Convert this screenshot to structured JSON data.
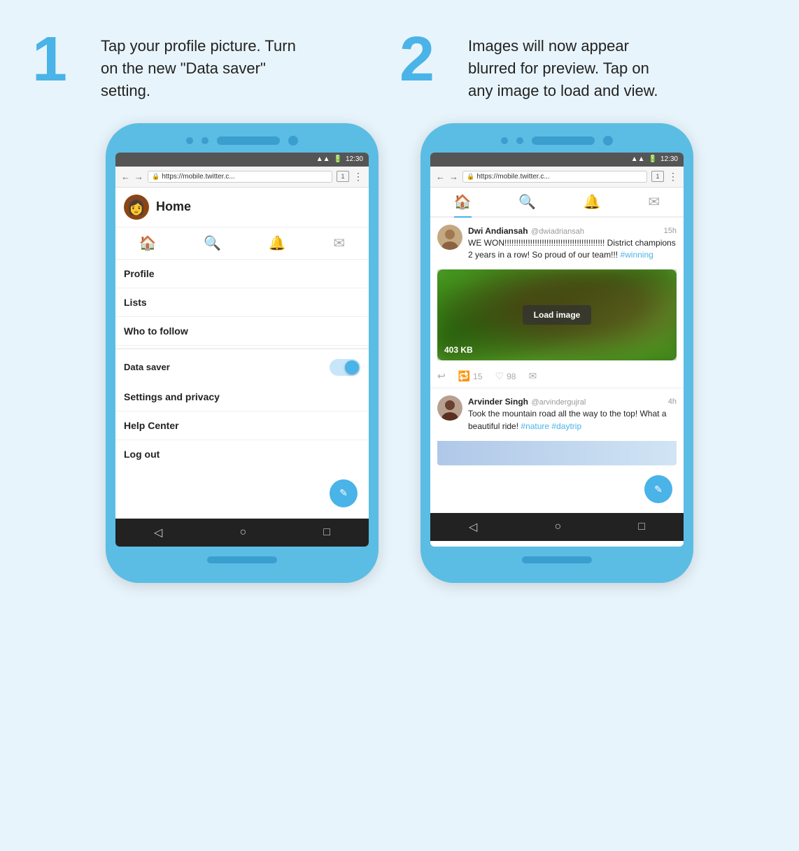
{
  "step1": {
    "number": "1",
    "text": "Tap your profile picture. Turn on the new \"Data saver\" setting."
  },
  "step2": {
    "number": "2",
    "text": "Images will now appear blurred for preview. Tap on any image to load and view."
  },
  "phone1": {
    "status_time": "12:30",
    "url": "https://mobile.twitter.c...",
    "tab_count": "1",
    "home_label": "Home",
    "menu_items": [
      {
        "label": "Profile"
      },
      {
        "label": "Lists"
      },
      {
        "label": "Who to follow"
      }
    ],
    "toggle_item": "Data saver",
    "settings_items": [
      {
        "label": "Settings and privacy"
      },
      {
        "label": "Help Center"
      },
      {
        "label": "Log out"
      }
    ],
    "fab_icon": "✎"
  },
  "phone2": {
    "status_time": "12:30",
    "url": "https://mobile.twitter.c...",
    "tab_count": "1",
    "tweet1": {
      "name": "Dwi Andiansah",
      "handle": "@dwiadriansah",
      "time": "15h",
      "text": "WE WON!!!!!!!!!!!!!!!!!!!!!!!!!!!!!!!!!!!!!!!!!!! District champions 2 years in a row! So proud of our team!!! ",
      "hashtag": "#winning",
      "load_image_label": "Load image",
      "image_size": "403 KB",
      "retweets": "15",
      "likes": "98"
    },
    "tweet2": {
      "name": "Arvinder Singh",
      "handle": "@arvindergujral",
      "time": "4h",
      "text": "Took the mountain road all the way to the top! What a beautiful ride! ",
      "hashtags": "#nature #daytrip"
    },
    "fab_icon": "✎"
  }
}
